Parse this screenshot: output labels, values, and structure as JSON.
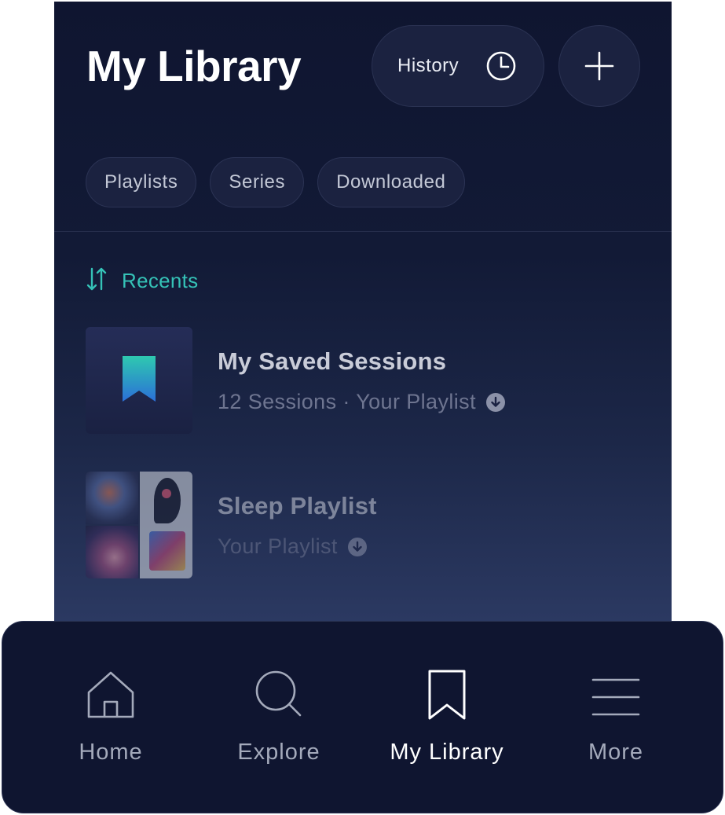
{
  "header": {
    "title": "My Library",
    "history_label": "History",
    "history_icon": "clock-icon",
    "add_icon": "plus-icon"
  },
  "filters": [
    {
      "label": "Playlists"
    },
    {
      "label": "Series"
    },
    {
      "label": "Downloaded"
    }
  ],
  "sort": {
    "icon": "sort-arrows-icon",
    "label": "Recents",
    "color": "#35c2b7"
  },
  "items": [
    {
      "title": "My Saved Sessions",
      "subtitle": "12 Sessions · Your Playlist",
      "thumb": "bookmark-icon",
      "downloaded": true
    },
    {
      "title": "Sleep Playlist",
      "subtitle": "Your Playlist",
      "thumb": "artwork-collage",
      "downloaded": true
    }
  ],
  "tabbar": {
    "tabs": [
      {
        "label": "Home",
        "icon": "home-icon",
        "active": false
      },
      {
        "label": "Explore",
        "icon": "search-icon",
        "active": false
      },
      {
        "label": "My Library",
        "icon": "bookmark-icon",
        "active": true
      },
      {
        "label": "More",
        "icon": "menu-icon",
        "active": false
      }
    ]
  },
  "colors": {
    "background": "#0f1530",
    "accent": "#35c2b7",
    "text_primary": "#ffffff",
    "text_secondary": "#a4aabb"
  }
}
